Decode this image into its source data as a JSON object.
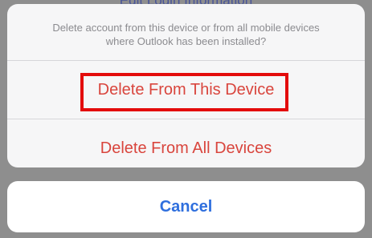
{
  "background": {
    "partial_title": "Edit Login Information"
  },
  "action_sheet": {
    "message_line1": "Delete account from this device or from all mobile devices",
    "message_line2": "where Outlook has been installed?",
    "delete_device_label": "Delete From This Device",
    "delete_all_label": "Delete From All Devices",
    "cancel_label": "Cancel"
  },
  "colors": {
    "destructive": "#d9453d",
    "cancel": "#2f6fde",
    "highlight_box": "#e30b0b"
  }
}
